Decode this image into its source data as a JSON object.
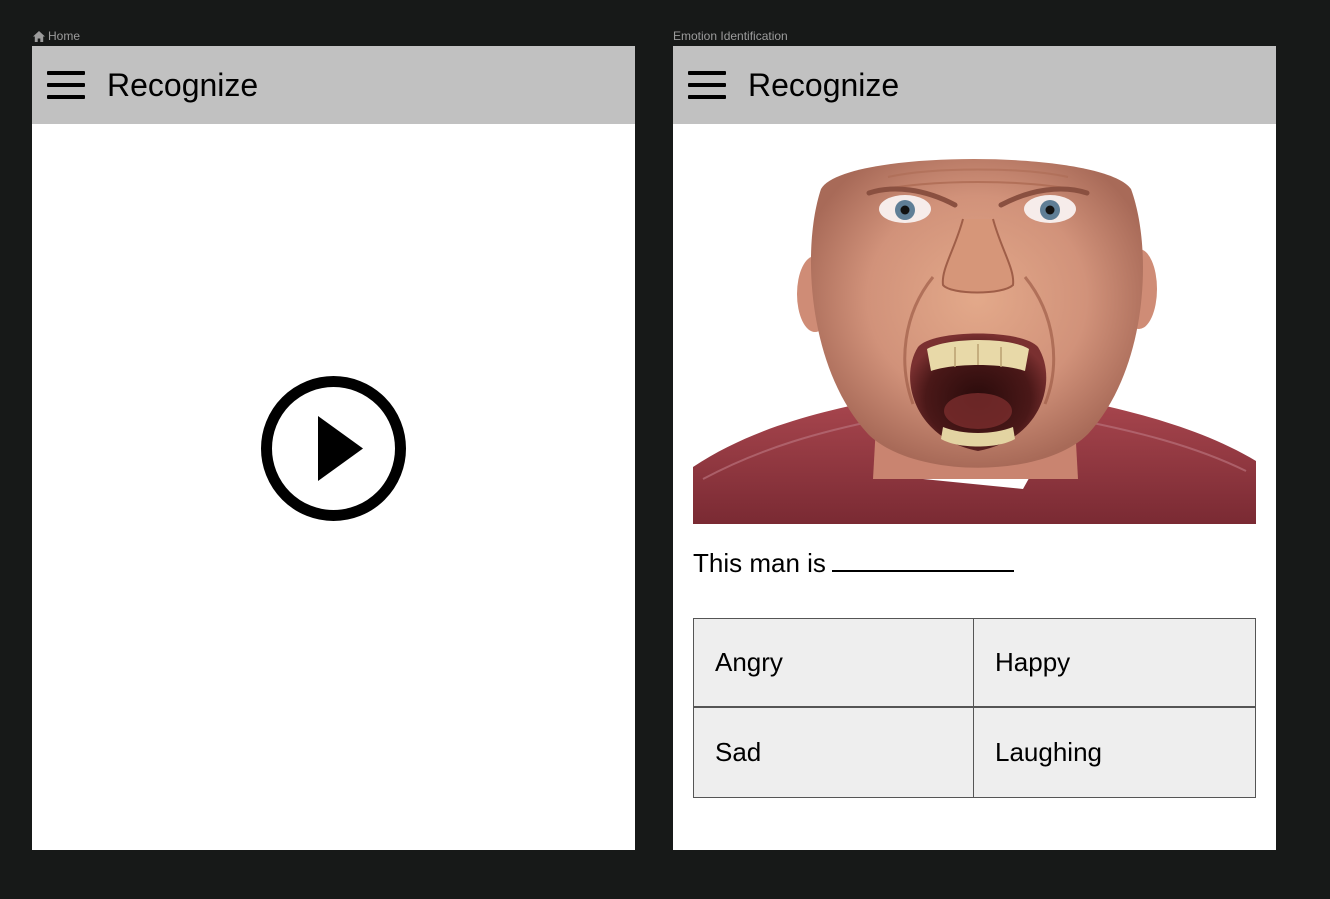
{
  "frames": {
    "home": {
      "label": "Home",
      "app_title": "Recognize"
    },
    "emotion": {
      "label": "Emotion Identification",
      "app_title": "Recognize",
      "question": "This man is",
      "answers": [
        "Angry",
        "Happy",
        "Sad",
        "Laughing"
      ]
    }
  },
  "icons": {
    "home_label_icon": "home-icon",
    "menu": "hamburger-menu-icon",
    "play": "play-circle-icon"
  },
  "colors": {
    "canvas": "#171918",
    "app_bar": "#c1c1c1",
    "answer_bg": "#eeeeee",
    "label_text": "#9c9c9c"
  }
}
